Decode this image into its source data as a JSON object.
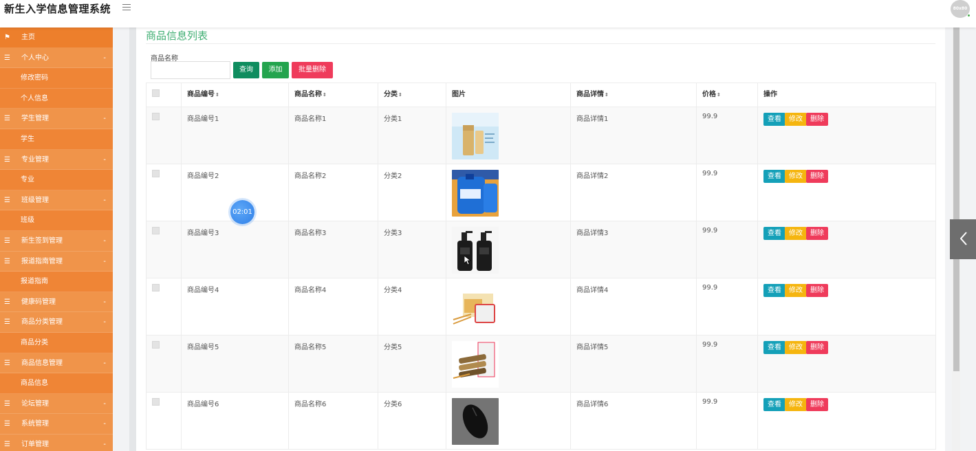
{
  "header": {
    "title": "新生入学信息管理系统",
    "avatar_text": "80x80"
  },
  "sidebar": {
    "items": [
      {
        "label": "主页",
        "kind": "top",
        "icon": "flag-icon"
      },
      {
        "label": "个人中心",
        "kind": "group",
        "icon": "menu-icon"
      },
      {
        "label": "修改密码",
        "kind": "sub"
      },
      {
        "label": "个人信息",
        "kind": "sub"
      },
      {
        "label": "学生管理",
        "kind": "group",
        "icon": "menu-icon"
      },
      {
        "label": "学生",
        "kind": "sub"
      },
      {
        "label": "专业管理",
        "kind": "group",
        "icon": "menu-icon"
      },
      {
        "label": "专业",
        "kind": "sub"
      },
      {
        "label": "班级管理",
        "kind": "group",
        "icon": "menu-icon"
      },
      {
        "label": "班级",
        "kind": "sub"
      },
      {
        "label": "新生签到管理",
        "kind": "group",
        "icon": "menu-icon"
      },
      {
        "label": "报道指南管理",
        "kind": "group",
        "icon": "menu-icon"
      },
      {
        "label": "报道指南",
        "kind": "sub"
      },
      {
        "label": "健康码管理",
        "kind": "group",
        "icon": "menu-icon"
      },
      {
        "label": "商品分类管理",
        "kind": "group",
        "icon": "menu-icon"
      },
      {
        "label": "商品分类",
        "kind": "sub"
      },
      {
        "label": "商品信息管理",
        "kind": "group",
        "icon": "menu-icon"
      },
      {
        "label": "商品信息",
        "kind": "sub"
      },
      {
        "label": "论坛管理",
        "kind": "group",
        "icon": "menu-icon"
      },
      {
        "label": "系统管理",
        "kind": "group",
        "icon": "menu-icon"
      },
      {
        "label": "订单管理",
        "kind": "group",
        "icon": "menu-icon"
      }
    ],
    "collapse_glyph": "-"
  },
  "main": {
    "panel_title": "商品信息列表",
    "search": {
      "label": "商品名称",
      "value": "",
      "placeholder": ""
    },
    "buttons": {
      "query": "查询",
      "add": "添加",
      "bulk_delete": "批量删除"
    },
    "table": {
      "columns": [
        "商品编号",
        "商品名称",
        "分类",
        "图片",
        "商品详情",
        "价格",
        "操作"
      ],
      "sortable": [
        true,
        true,
        true,
        false,
        true,
        true,
        false
      ],
      "sort_glyph": "⇕",
      "rows": [
        {
          "code": "商品编号1",
          "name": "商品名称1",
          "category": "分类1",
          "image": "sunscreen-product-image",
          "detail": "商品详情1",
          "price": "99.9"
        },
        {
          "code": "商品编号2",
          "name": "商品名称2",
          "category": "分类2",
          "image": "detergent-bottle-image",
          "detail": "商品详情2",
          "price": "99.9"
        },
        {
          "code": "商品编号3",
          "name": "商品名称3",
          "category": "分类3",
          "image": "pump-bottles-image",
          "detail": "商品详情3",
          "price": "99.9"
        },
        {
          "code": "商品编号4",
          "name": "商品名称4",
          "category": "分类4",
          "image": "cake-snack-image",
          "detail": "商品详情4",
          "price": "99.9"
        },
        {
          "code": "商品编号5",
          "name": "商品名称5",
          "category": "分类5",
          "image": "biscuit-sticks-image",
          "detail": "商品详情5",
          "price": "99.9"
        },
        {
          "code": "商品编号6",
          "name": "商品名称6",
          "category": "分类6",
          "image": "computer-mouse-image",
          "detail": "商品详情6",
          "price": "99.9"
        }
      ],
      "row_actions": {
        "view": "查看",
        "edit": "修改",
        "delete": "删除"
      }
    }
  },
  "overlay": {
    "timer": "02:01"
  },
  "colors": {
    "sidebar": "#ef8b3a",
    "title_green": "#3fae72",
    "btn_query": "#0f8d5f",
    "btn_add": "#24a44e",
    "btn_delete": "#ef3b5b",
    "btn_view": "#14a0b8",
    "btn_edit": "#f5b50f"
  }
}
